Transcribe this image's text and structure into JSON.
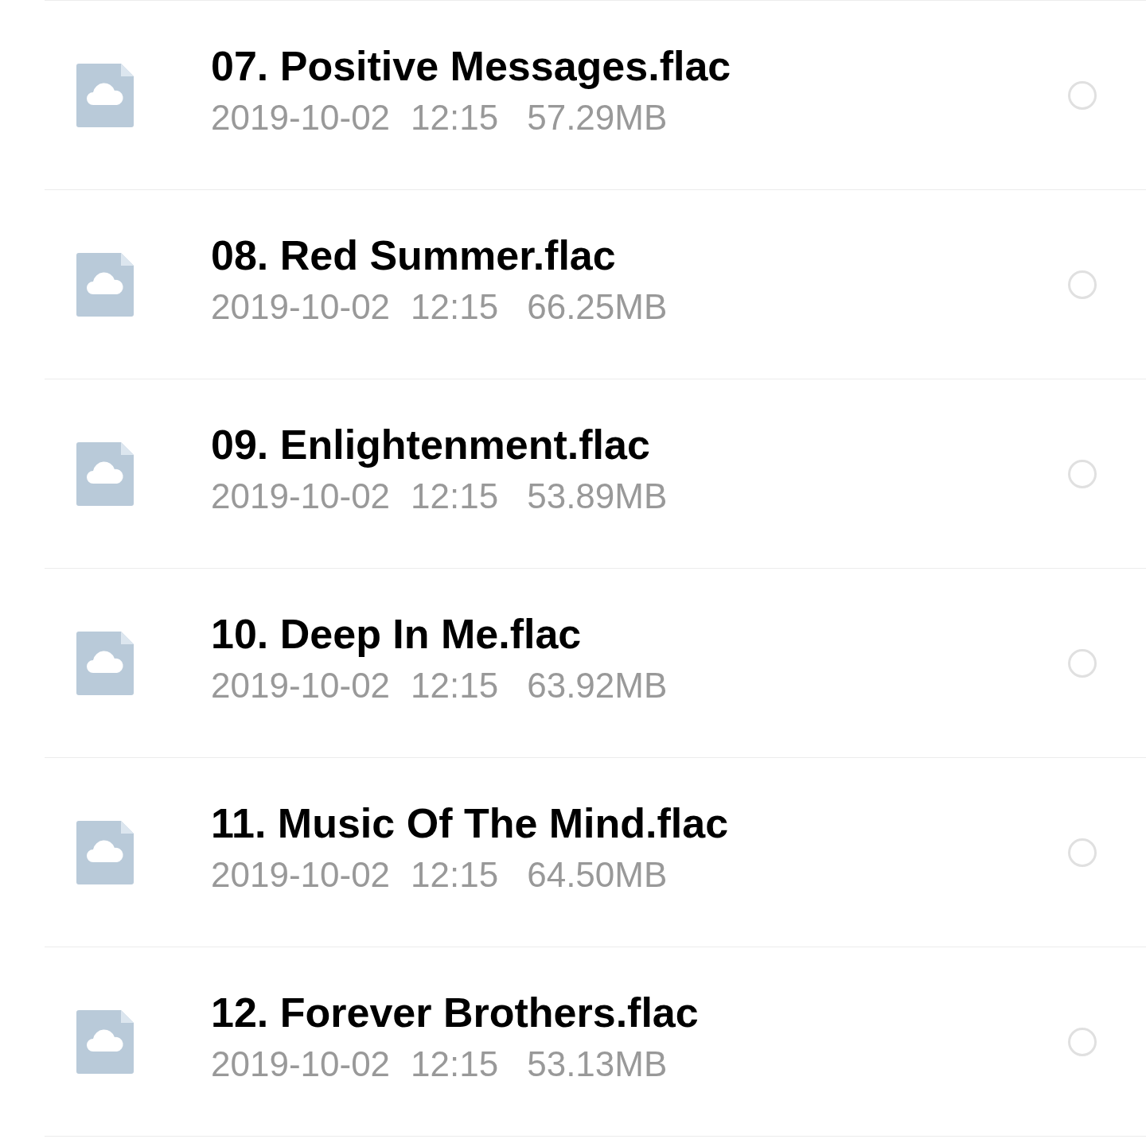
{
  "files": [
    {
      "name": "07. Positive Messages.flac",
      "date": "2019-10-02",
      "time": "12:15",
      "size": "57.29MB",
      "selected": false
    },
    {
      "name": "08. Red Summer.flac",
      "date": "2019-10-02",
      "time": "12:15",
      "size": "66.25MB",
      "selected": false
    },
    {
      "name": "09. Enlightenment.flac",
      "date": "2019-10-02",
      "time": "12:15",
      "size": "53.89MB",
      "selected": false
    },
    {
      "name": "10. Deep In Me.flac",
      "date": "2019-10-02",
      "time": "12:15",
      "size": "63.92MB",
      "selected": false
    },
    {
      "name": "11. Music Of The Mind.flac",
      "date": "2019-10-02",
      "time": "12:15",
      "size": "64.50MB",
      "selected": false
    },
    {
      "name": "12. Forever Brothers.flac",
      "date": "2019-10-02",
      "time": "12:15",
      "size": "53.13MB",
      "selected": false
    }
  ]
}
